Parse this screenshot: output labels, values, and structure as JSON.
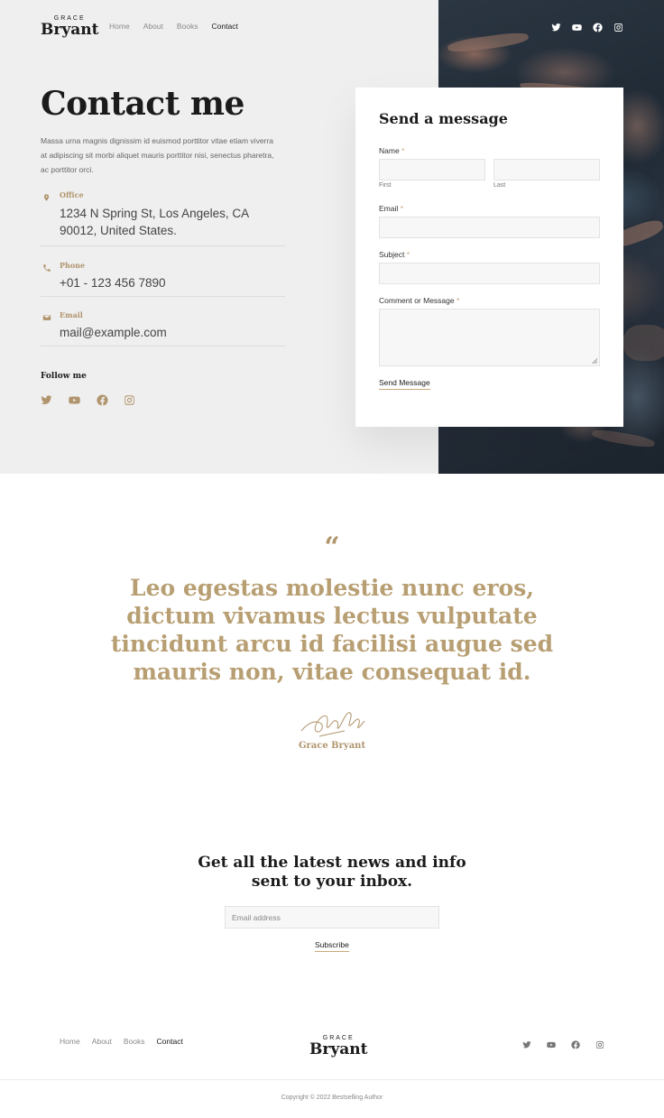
{
  "brand": {
    "small": "GRACE",
    "big": "Bryant"
  },
  "nav": [
    {
      "label": "Home",
      "active": false
    },
    {
      "label": "About",
      "active": false
    },
    {
      "label": "Books",
      "active": false
    },
    {
      "label": "Contact",
      "active": true
    }
  ],
  "social_icons": [
    "twitter-icon",
    "youtube-icon",
    "facebook-icon",
    "instagram-icon"
  ],
  "hero": {
    "title": "Contact me",
    "intro": "Massa urna magnis dignissim id euismod porttitor vitae etiam viverra at adipiscing sit morbi aliquet mauris porttitor nisi, senectus pharetra, ac porttitor orci."
  },
  "contact": {
    "office": {
      "label": "Office",
      "value": "1234 N Spring St, Los Angeles, CA 90012, United States.",
      "icon": "map-pin-icon"
    },
    "phone": {
      "label": "Phone",
      "value": "+01 - 123 456 7890",
      "icon": "phone-icon"
    },
    "email": {
      "label": "Email",
      "value": "mail@example.com",
      "icon": "envelope-icon"
    }
  },
  "follow": {
    "title": "Follow me"
  },
  "form": {
    "title": "Send a message",
    "name_label": "Name",
    "first_sublabel": "First",
    "last_sublabel": "Last",
    "email_label": "Email",
    "subject_label": "Subject",
    "message_label": "Comment or Message",
    "required_mark": "*",
    "submit_label": "Send Message"
  },
  "quote": {
    "mark": "“",
    "text": "Leo egestas molestie nunc eros, dictum vivamus lectus vulputate tincidunt arcu id facilisi augue sed mauris non, vitae consequat id.",
    "author": "Grace Bryant"
  },
  "newsletter": {
    "title_line1": "Get all the latest news and info",
    "title_line2": "sent to your inbox.",
    "placeholder": "Email address",
    "button": "Subscribe"
  },
  "footer": {
    "copyright": "Copyright © 2022 Bestselling Author"
  },
  "colors": {
    "accent": "#b0946c",
    "hero_bg": "#efefef",
    "text_dark": "#1b1b1b"
  }
}
